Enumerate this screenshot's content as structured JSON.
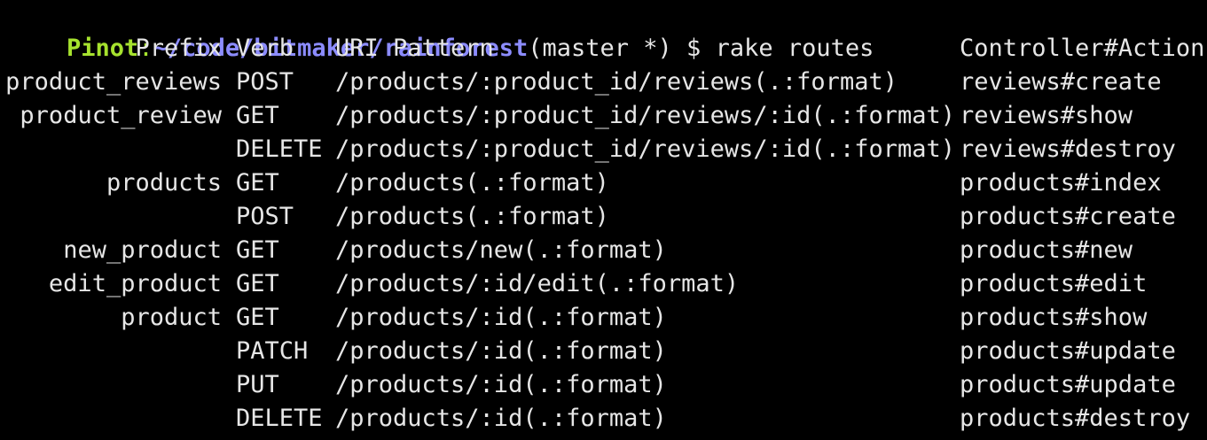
{
  "terminal": {
    "prompt": {
      "user": "Pinot",
      "colon": ":",
      "path": "~/code/bitmaker/rainforest",
      "branch": "(master *)",
      "symbol": " $ ",
      "command": "rake routes"
    },
    "headers": {
      "prefix": "Prefix",
      "verb": "Verb",
      "uri": "URI Pattern",
      "action": "Controller#Action"
    },
    "rows": [
      {
        "prefix": "product_reviews",
        "verb": "POST",
        "uri": "/products/:product_id/reviews(.:format)",
        "action": "reviews#create"
      },
      {
        "prefix": "product_review",
        "verb": "GET",
        "uri": "/products/:product_id/reviews/:id(.:format)",
        "action": "reviews#show"
      },
      {
        "prefix": "",
        "verb": "DELETE",
        "uri": "/products/:product_id/reviews/:id(.:format)",
        "action": "reviews#destroy"
      },
      {
        "prefix": "products",
        "verb": "GET",
        "uri": "/products(.:format)",
        "action": "products#index"
      },
      {
        "prefix": "",
        "verb": "POST",
        "uri": "/products(.:format)",
        "action": "products#create"
      },
      {
        "prefix": "new_product",
        "verb": "GET",
        "uri": "/products/new(.:format)",
        "action": "products#new"
      },
      {
        "prefix": "edit_product",
        "verb": "GET",
        "uri": "/products/:id/edit(.:format)",
        "action": "products#edit"
      },
      {
        "prefix": "product",
        "verb": "GET",
        "uri": "/products/:id(.:format)",
        "action": "products#show"
      },
      {
        "prefix": "",
        "verb": "PATCH",
        "uri": "/products/:id(.:format)",
        "action": "products#update"
      },
      {
        "prefix": "",
        "verb": "PUT",
        "uri": "/products/:id(.:format)",
        "action": "products#update"
      },
      {
        "prefix": "",
        "verb": "DELETE",
        "uri": "/products/:id(.:format)",
        "action": "products#destroy"
      }
    ],
    "colors": {
      "background": "#000000",
      "text": "#e6e6e6",
      "user": "#a6e22e",
      "path": "#8c8cff"
    }
  }
}
